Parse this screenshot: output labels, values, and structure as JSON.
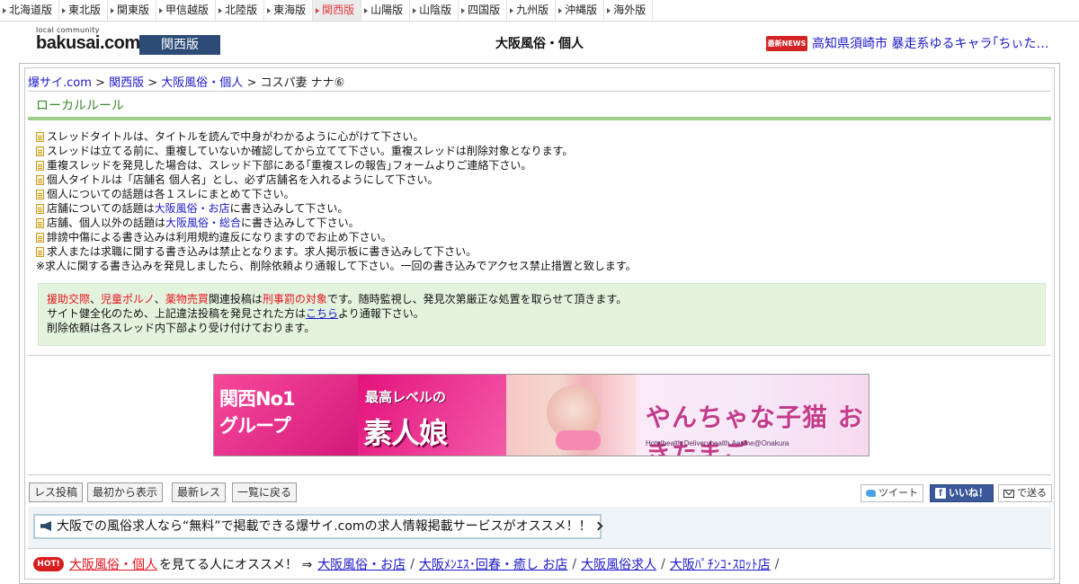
{
  "region_nav": {
    "items": [
      "北海道版",
      "東北版",
      "関東版",
      "甲信越版",
      "北陸版",
      "東海版",
      "関西版",
      "山陽版",
      "山陰版",
      "四国版",
      "九州版",
      "沖縄版",
      "海外版"
    ],
    "active": "関西版"
  },
  "header": {
    "logo_small": "local community",
    "logo_main": "bakusai.com",
    "edition_badge": "関西版",
    "board_title": "大阪風俗・個人",
    "news_badge": "最新NEWS",
    "news_headline": "高知県須崎市 暴走系ゆるキャラ｢ちぃた…"
  },
  "breadcrumb": {
    "items": [
      "爆サイ.com",
      "関西版",
      "大阪風俗・個人"
    ],
    "separator": ">",
    "current": "コスパ妻 ナナ⑥"
  },
  "local_rules": {
    "title": "ローカルルール",
    "rules": [
      "スレッドタイトルは、タイトルを読んで中身がわかるように心がけて下さい。",
      "スレッドは立てる前に、重複していないか確認してから立てて下さい。重複スレッドは削除対象となります。",
      "重複スレッドを発見した場合は、スレッド下部にある｢重複スレの報告｣フォームよりご連絡下さい。",
      "個人タイトルは「店舗名 個人名」とし、必ず店舗名を入れるようにして下さい。",
      "個人についての話題は各１スレにまとめて下さい。"
    ],
    "rule_shop": {
      "before": "店舗についての話題は",
      "link": "大阪風俗・お店",
      "after": "に書き込みして下さい。"
    },
    "rule_other": {
      "before": "店舗、個人以外の話題は",
      "link": "大阪風俗・総合",
      "after": "に書き込みして下さい。"
    },
    "rule_slander": "誹謗中傷による書き込みは利用規約違反になりますのでお止め下さい。",
    "rule_recruit": "求人または求職に関する書き込みは禁止となります。求人掲示板に書き込みして下さい。",
    "note": "※求人に関する書き込みを発見しましたら、削除依頼より通報して下さい。一回の書き込みでアクセス禁止措置と致します。"
  },
  "warning": {
    "term1": "援助交際",
    "comma1": "、",
    "term2": "児童ポルノ",
    "comma2": "、",
    "term3": "薬物売買",
    "mid": "関連投稿は",
    "term4": "刑事罰の対象",
    "end": "です。随時監視し、発見次第厳正な処置を取らせて頂きます。",
    "line2_before": "サイト健全化のため、上記違法投稿を発見された方は",
    "line2_link": "こちら",
    "line2_after": "より通報下さい。",
    "line3": "削除依頼は各スレッド内下部より受け付けております。"
  },
  "banner": {
    "left_line1": "関西No1",
    "left_line2": "グループ",
    "mid_line1": "最高レベルの",
    "mid_line2": "素人娘",
    "brand": "やんちゃな子猫 おきたまご",
    "sub": "Hotelhealth.Deliveryhealth.Aesthe@Onakura"
  },
  "actions": {
    "post": "レス投稿",
    "from_start": "最初から表示",
    "latest": "最新レス",
    "back_to_list": "一覧に戻る",
    "tweet": "ツイート",
    "like": "いいね！",
    "send": "で送る"
  },
  "recruit_notice": "大阪での風俗求人なら“無料”で掲載できる爆サイ.comの求人情報掲載サービスがオススメ！！",
  "recommend": {
    "badge": "HOT!",
    "main": "大阪風俗・個人",
    "text": "を見てる人にオススメ！ ⇒",
    "links": [
      "大阪風俗・お店",
      "大阪ﾒﾝｴｽ･回春・癒し お店",
      "大阪風俗求人",
      "大阪ﾊﾟﾁﾝｺ･ｽﾛｯﾄ店"
    ],
    "separator": "/"
  },
  "colors": {
    "edition_badge_bg": "#2c4c77",
    "active_tab_text": "#e2383f",
    "link": "#1b18c9",
    "warning_red": "#e5141f",
    "rule_green": "#3c8a2c",
    "warning_bg": "#e4f3de",
    "facebook": "#3b5998"
  },
  "icons": [
    "triangle-arrow-icon",
    "news-badge-icon",
    "document-icon",
    "megaphone-icon",
    "chevron-right-icon",
    "twitter-bird-icon",
    "facebook-f-icon",
    "envelope-icon",
    "hot-badge-icon"
  ]
}
